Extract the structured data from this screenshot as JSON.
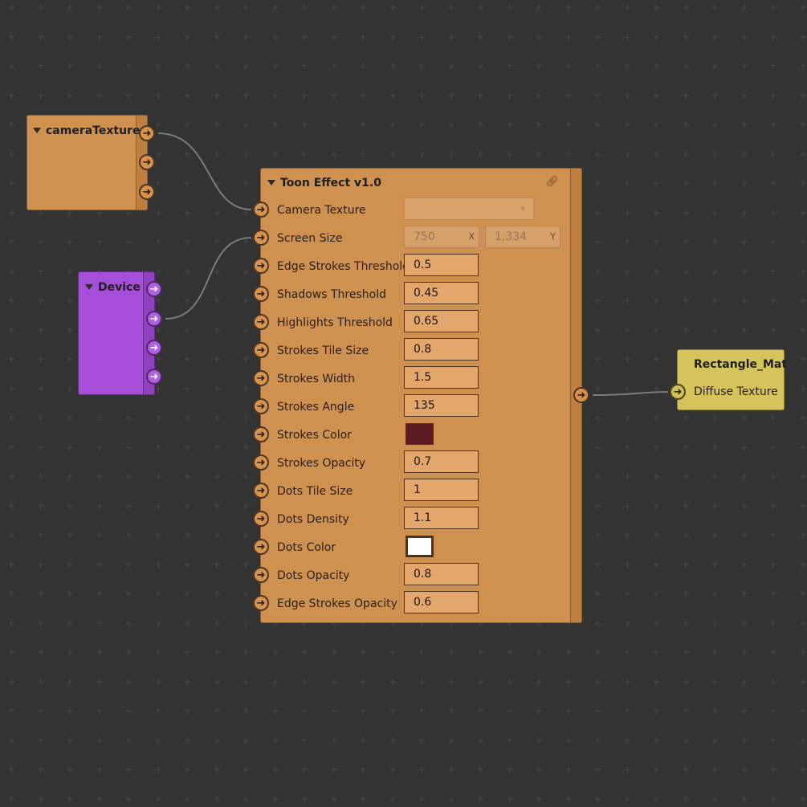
{
  "colors": {
    "canvas_bg": "#333333",
    "grid_cross": "#4a4a4a",
    "camera_node": "#cf9150",
    "device_node": "#a64ed9",
    "toon_node": "#cf9150",
    "material_node": "#d5c35c",
    "wire": "#7a7a7a",
    "strokes_color_value": "#5c1a22",
    "dots_color_value": "#ffffff"
  },
  "camera_node": {
    "title": "cameraTexture",
    "output_port_icon": "arrow-right-icon"
  },
  "device_node": {
    "title": "Device",
    "output_port_icon": "arrow-right-icon"
  },
  "toon_node": {
    "title": "Toon Effect v1.0",
    "link_icon": "link-icon",
    "rows": {
      "camera_texture": {
        "label": "Camera Texture"
      },
      "screen_size": {
        "label": "Screen Size",
        "x_value": "750",
        "x_axis": "X",
        "y_value": "1,334",
        "y_axis": "Y"
      },
      "edge_strokes_threshold": {
        "label": "Edge Strokes Threshold",
        "value": "0.5"
      },
      "shadows_threshold": {
        "label": "Shadows Threshold",
        "value": "0.45"
      },
      "highlights_threshold": {
        "label": "Highlights Threshold",
        "value": "0.65"
      },
      "strokes_tile_size": {
        "label": "Strokes Tile Size",
        "value": "0.8"
      },
      "strokes_width": {
        "label": "Strokes Width",
        "value": "1.5"
      },
      "strokes_angle": {
        "label": "Strokes Angle",
        "value": "135"
      },
      "strokes_color": {
        "label": "Strokes Color"
      },
      "strokes_opacity": {
        "label": "Strokes Opacity",
        "value": "0.7"
      },
      "dots_tile_size": {
        "label": "Dots Tile Size",
        "value": "1"
      },
      "dots_density": {
        "label": "Dots Density",
        "value": "1.1"
      },
      "dots_color": {
        "label": "Dots Color"
      },
      "dots_opacity": {
        "label": "Dots Opacity",
        "value": "0.8"
      },
      "edge_strokes_opacity": {
        "label": "Edge Strokes Opacity",
        "value": "0.6"
      }
    }
  },
  "material_node": {
    "title": "Rectangle_Mat",
    "input_label": "Diffuse Texture"
  }
}
